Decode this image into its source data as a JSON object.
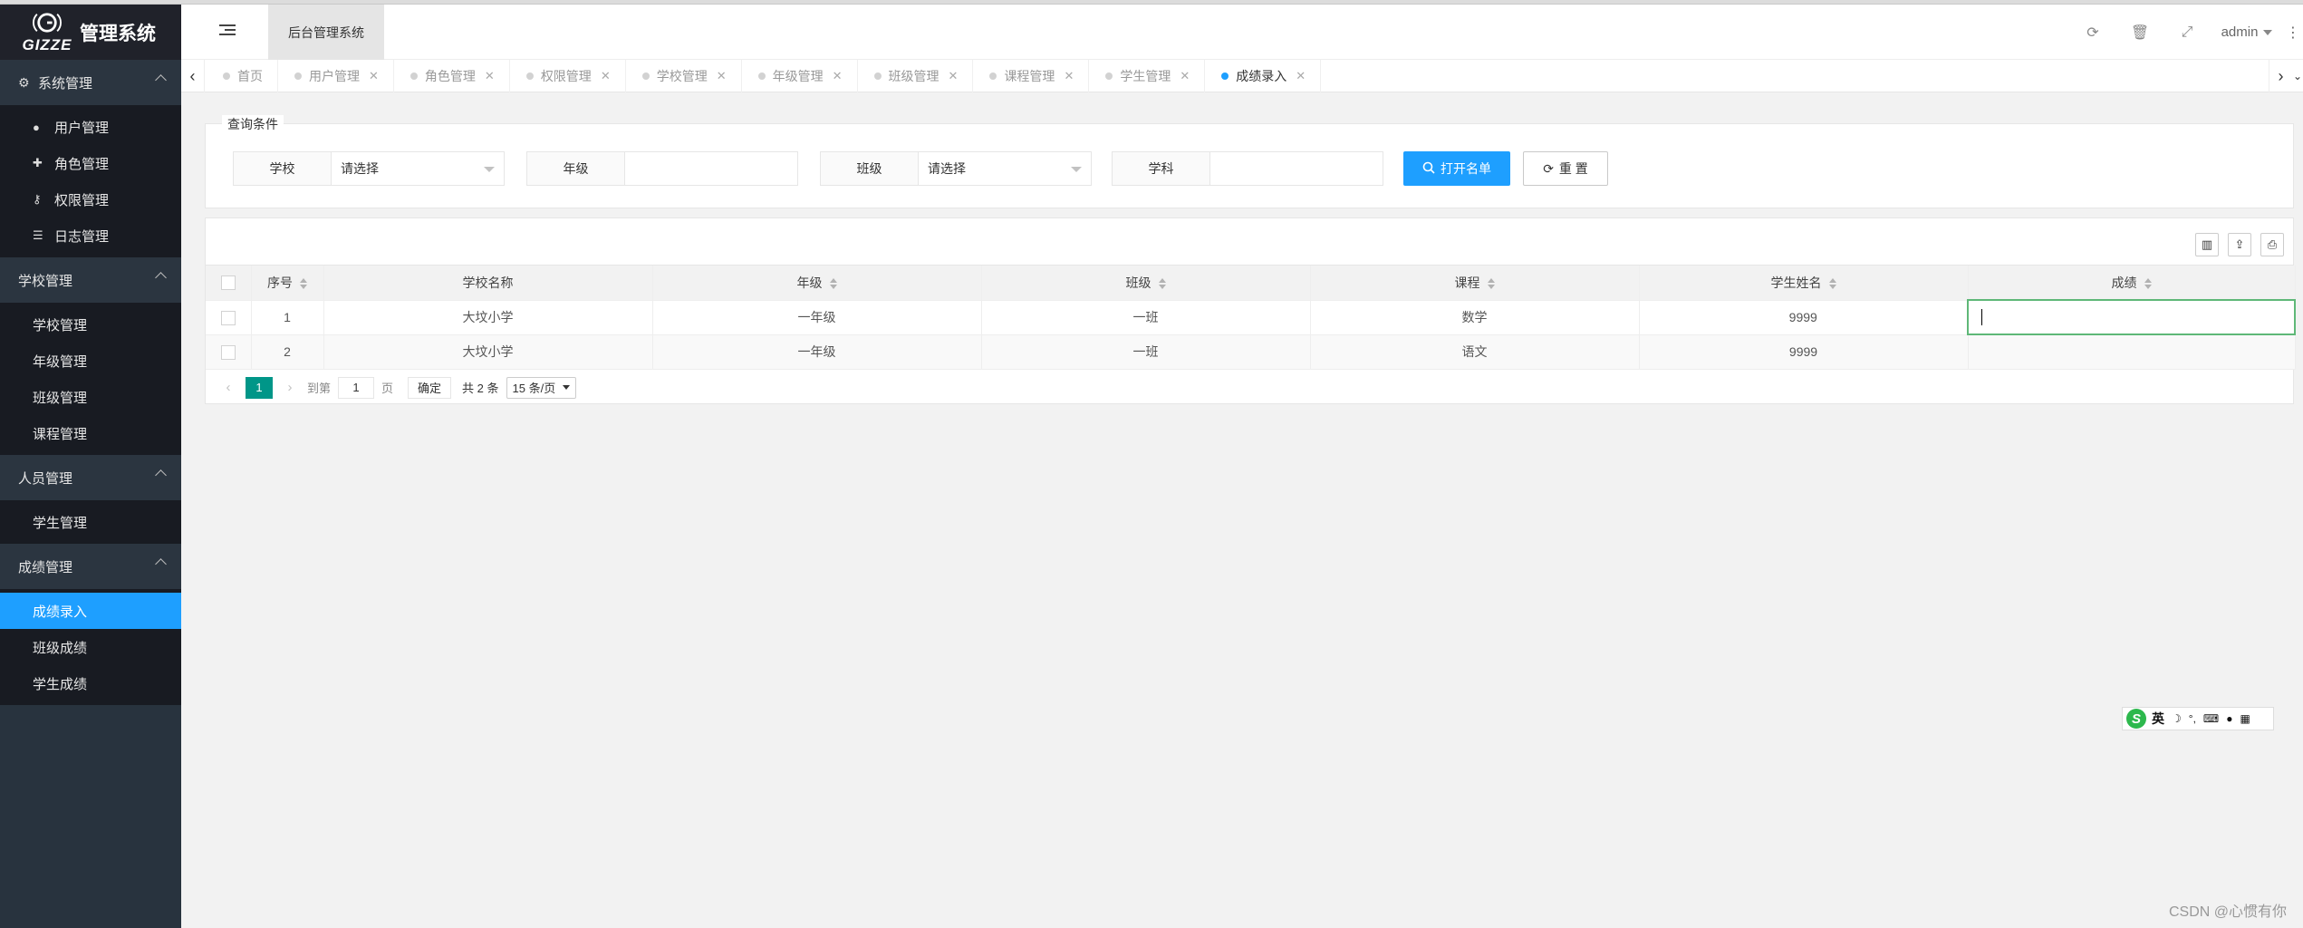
{
  "app": {
    "logo_text": "GIZZE",
    "title": "管理系统"
  },
  "header": {
    "system_tab": "后台管理系统",
    "user": "admin",
    "icons": [
      "refresh-icon",
      "trash-icon",
      "fullscreen-icon",
      "more-icon"
    ]
  },
  "sidebar": {
    "groups": [
      {
        "label": "系统管理",
        "items": [
          {
            "label": "用户管理",
            "icon": "user-icon"
          },
          {
            "label": "角色管理",
            "icon": "user-add-icon"
          },
          {
            "label": "权限管理",
            "icon": "key-icon"
          },
          {
            "label": "日志管理",
            "icon": "list-icon"
          }
        ]
      },
      {
        "label": "学校管理",
        "items": [
          {
            "label": "学校管理"
          },
          {
            "label": "年级管理"
          },
          {
            "label": "班级管理"
          },
          {
            "label": "课程管理"
          }
        ]
      },
      {
        "label": "人员管理",
        "items": [
          {
            "label": "学生管理"
          }
        ]
      },
      {
        "label": "成绩管理",
        "items": [
          {
            "label": "成绩录入",
            "active": true
          },
          {
            "label": "班级成绩"
          },
          {
            "label": "学生成绩"
          }
        ]
      }
    ]
  },
  "tabs": [
    {
      "label": "首页"
    },
    {
      "label": "用户管理"
    },
    {
      "label": "角色管理"
    },
    {
      "label": "权限管理"
    },
    {
      "label": "学校管理"
    },
    {
      "label": "年级管理"
    },
    {
      "label": "班级管理"
    },
    {
      "label": "课程管理"
    },
    {
      "label": "学生管理"
    },
    {
      "label": "成绩录入",
      "active": true
    }
  ],
  "query": {
    "legend": "查询条件",
    "school": {
      "label": "学校",
      "value": "请选择"
    },
    "grade": {
      "label": "年级",
      "value": ""
    },
    "class": {
      "label": "班级",
      "value": "请选择"
    },
    "subject": {
      "label": "学科",
      "value": ""
    },
    "open_button": "打开名单",
    "reset_button": "重 置"
  },
  "table": {
    "columns": [
      "序号",
      "学校名称",
      "年级",
      "班级",
      "课程",
      "学生姓名",
      "成绩"
    ],
    "rows": [
      [
        "1",
        "大坟小学",
        "一年级",
        "一班",
        "数学",
        "9999",
        ""
      ],
      [
        "2",
        "大坟小学",
        "一年级",
        "一班",
        "语文",
        "9999",
        ""
      ]
    ]
  },
  "pager": {
    "current": "1",
    "goto_label": "到第",
    "goto_value": "1",
    "page_label": "页",
    "ok": "确定",
    "total": "共 2 条",
    "page_size": "15 条/页"
  },
  "ime": {
    "mode": "英"
  },
  "watermark": "CSDN @心惯有你",
  "colors": {
    "primary": "#1e9fff",
    "sidebar": "#28333e",
    "pager_active": "#009688",
    "edit_border": "#5fb878"
  }
}
